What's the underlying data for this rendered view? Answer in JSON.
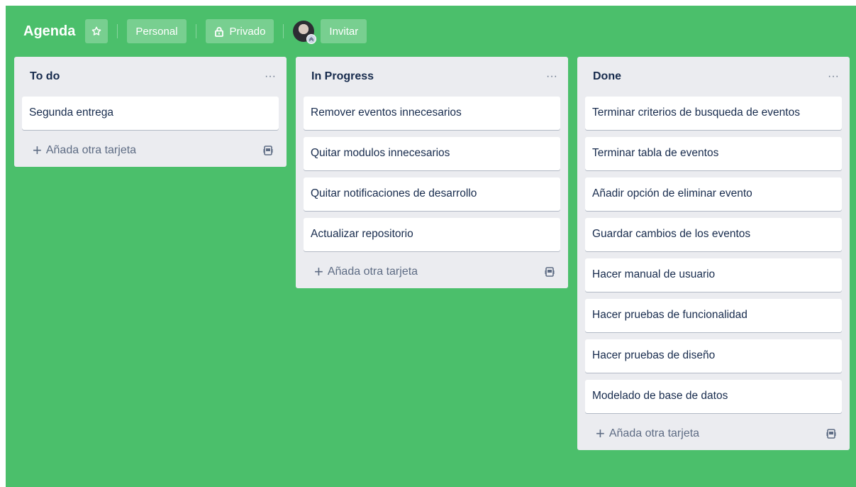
{
  "header": {
    "title": "Agenda",
    "personal_label": "Personal",
    "private_label": "Privado",
    "invite_label": "Invitar",
    "board_color": "#4bbf6b"
  },
  "lists": [
    {
      "title": "To do",
      "cards": [
        "Segunda entrega"
      ],
      "add_label": "Añada otra tarjeta"
    },
    {
      "title": "In Progress",
      "cards": [
        "Remover eventos innecesarios",
        "Quitar modulos innecesarios",
        "Quitar notificaciones de desarrollo",
        "Actualizar repositorio"
      ],
      "add_label": "Añada otra tarjeta"
    },
    {
      "title": "Done",
      "cards": [
        "Terminar criterios de busqueda de eventos",
        "Terminar tabla de eventos",
        "Añadir opción de eliminar evento",
        "Guardar cambios de los eventos",
        "Hacer manual de usuario",
        "Hacer pruebas de funcionalidad",
        "Hacer pruebas de diseño",
        "Modelado de base de datos"
      ],
      "add_label": "Añada otra tarjeta"
    }
  ],
  "icons": {
    "star": "star-icon",
    "lock": "lock-icon",
    "menu": "more-horizontal-icon",
    "add": "plus-icon",
    "template": "card-template-icon"
  }
}
